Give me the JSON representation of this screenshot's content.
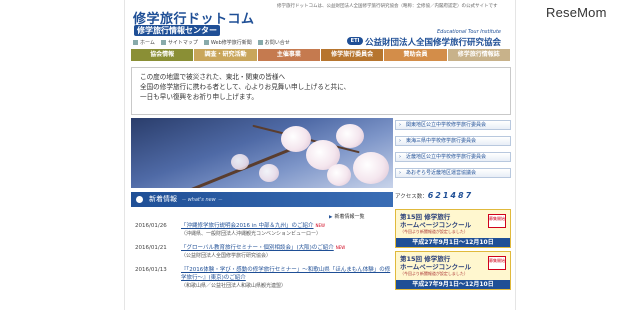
{
  "header": {
    "tagline": "修学旅行ドットコムは、公益財団法人全国修学旅行研究協会（略称：全修協／内閣府認定）の公式サイトです",
    "site_title": "修学旅行ドットコム",
    "subtitle": "修学旅行情報センター",
    "org_en": "Educational Tour Institute",
    "org_badge": "ETI",
    "org_name": "公益財団法人全国修学旅行研究協会",
    "util_links": [
      "ホーム",
      "サイトマップ",
      "Web修学旅行新聞",
      "お問い合せ"
    ]
  },
  "nav": [
    "協会情報",
    "調査・研究活動",
    "主催事業",
    "修学旅行委員会",
    "賛助会員",
    "修学旅行情報誌"
  ],
  "notice": {
    "lines": [
      "この度の地震で被災された、東北・関東の皆様へ",
      "全国の修学旅行に携わる者として、心よりお見舞い申し上げると共に、",
      "一日も早い復興をお祈り申し上げます。"
    ]
  },
  "side_links": [
    "関東地区公立中学校修学旅行委員会",
    "東海三県中学校修学旅行委員会",
    "近畿地区公立中学校修学旅行委員会",
    "あおぞら号近畿地区運営協議会"
  ],
  "access": {
    "label": "アクセス数：",
    "count": "621487"
  },
  "news": {
    "heading": "新着情報",
    "heading_en": "－ what's new －",
    "more": "新着情報一覧",
    "items": [
      {
        "date": "2016/01/26",
        "title": "「沖縄修学旅行説明会2016 in 中部＆九州」のご紹介",
        "badge": "NEW",
        "source": "（沖縄県、一般財団法人沖縄観光コンベンションビューロー）"
      },
      {
        "date": "2016/01/21",
        "title": "「グローバル教育旅行セミナー・個別相談会」(大阪)のご紹介",
        "badge": "NEW",
        "source": "（公益財団法人全国修学旅行研究協会）"
      },
      {
        "date": "2016/01/13",
        "title": "『「2016体験・学び・感動の修学旅行セミナー」～和歌山県「ほんまもん体験」の修学旅行～』(東京)のご紹介",
        "badge": "",
        "source": "（和歌山県／公益社団法人和歌山県観光連盟）"
      }
    ]
  },
  "banners": [
    {
      "title_l1": "第15回 修学旅行",
      "title_l2": "ホームページコンクール",
      "sub": "（今回より新聞報道が設定しました）",
      "badge": "募集開始",
      "dates": "平成27年9月1日～12月10日"
    },
    {
      "title_l1": "第15回 修学旅行",
      "title_l2": "ホームページコンクール",
      "sub": "（今回より新聞報道が設定しました）",
      "badge": "募集開始",
      "dates": "平成27年9月1日～12月10日"
    }
  ],
  "watermark": "ReseMom"
}
